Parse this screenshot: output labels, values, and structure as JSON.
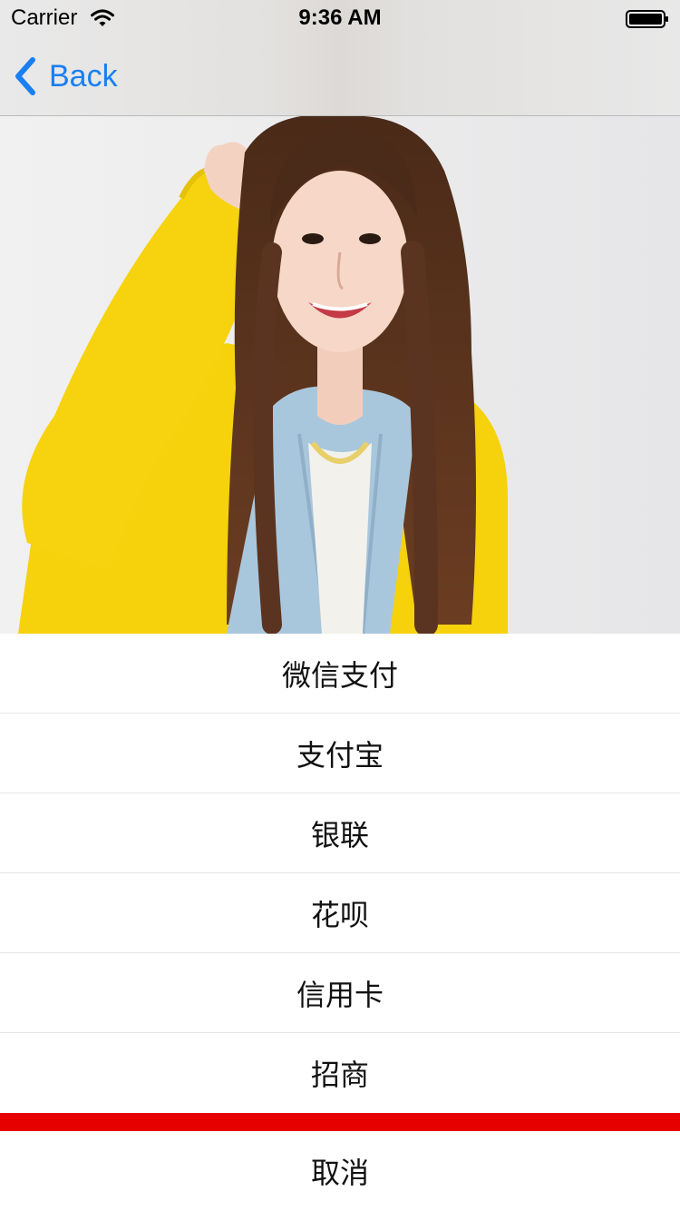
{
  "status_bar": {
    "carrier": "Carrier",
    "time": "9:36 AM"
  },
  "nav": {
    "back_label": "Back"
  },
  "action_sheet": {
    "options": [
      {
        "label": "微信支付"
      },
      {
        "label": "支付宝"
      },
      {
        "label": "银联"
      },
      {
        "label": "花呗"
      },
      {
        "label": "信用卡"
      },
      {
        "label": "招商"
      }
    ],
    "cancel_label": "取消"
  },
  "colors": {
    "accent_blue": "#1a7ff0",
    "separator_red": "#e60000"
  }
}
